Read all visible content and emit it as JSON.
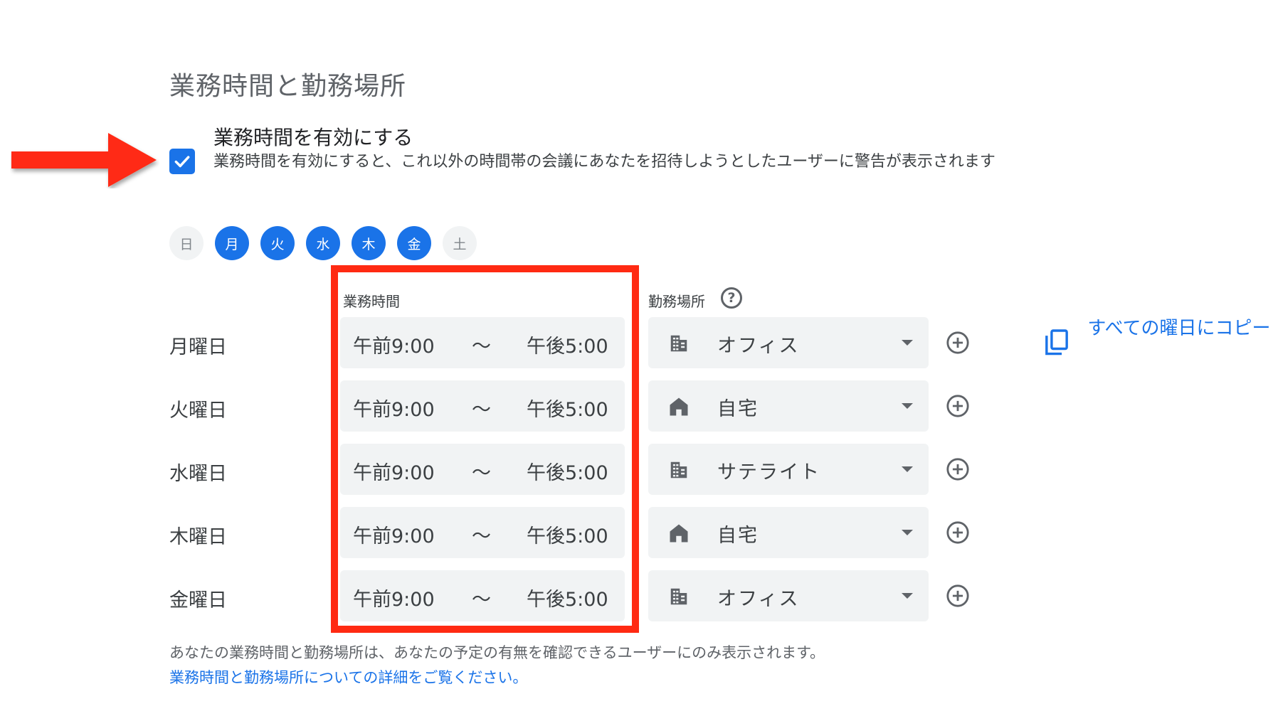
{
  "section_title": "業務時間と勤務場所",
  "enable": {
    "checked": true,
    "label": "業務時間を有効にする",
    "description": "業務時間を有効にすると、これ以外の時間帯の会議にあなたを招待しようとしたユーザーに警告が表示されます"
  },
  "weekdays": [
    {
      "label": "日",
      "selected": false
    },
    {
      "label": "月",
      "selected": true
    },
    {
      "label": "火",
      "selected": true
    },
    {
      "label": "水",
      "selected": true
    },
    {
      "label": "木",
      "selected": true
    },
    {
      "label": "金",
      "selected": true
    },
    {
      "label": "土",
      "selected": false
    }
  ],
  "headers": {
    "working_hours": "業務時間",
    "location": "勤務場所",
    "help_icon": "help-icon"
  },
  "rows": [
    {
      "day": "月曜日",
      "start": "午前9:00",
      "separator": "〜",
      "end": "午後5:00",
      "location": "オフィス",
      "location_icon": "office-building-icon"
    },
    {
      "day": "火曜日",
      "start": "午前9:00",
      "separator": "〜",
      "end": "午後5:00",
      "location": "自宅",
      "location_icon": "home-icon"
    },
    {
      "day": "水曜日",
      "start": "午前9:00",
      "separator": "〜",
      "end": "午後5:00",
      "location": "サテライト",
      "location_icon": "office-building-icon"
    },
    {
      "day": "木曜日",
      "start": "午前9:00",
      "separator": "〜",
      "end": "午後5:00",
      "location": "自宅",
      "location_icon": "home-icon"
    },
    {
      "day": "金曜日",
      "start": "午前9:00",
      "separator": "〜",
      "end": "午後5:00",
      "location": "オフィス",
      "location_icon": "office-building-icon"
    }
  ],
  "copy_all": {
    "label": "すべての曜日にコピー",
    "icon": "copy-icon"
  },
  "footer": {
    "note": "あなたの業務時間と勤務場所は、あなたの予定の有無を確認できるユーザーにのみ表示されます。",
    "link": "業務時間と勤務場所についての詳細をご覧ください。"
  },
  "colors": {
    "accent": "#1a73e8",
    "annotation_red": "#ff2a12",
    "field_bg": "#f1f3f4",
    "day_off_bg": "#f1f3f4"
  }
}
